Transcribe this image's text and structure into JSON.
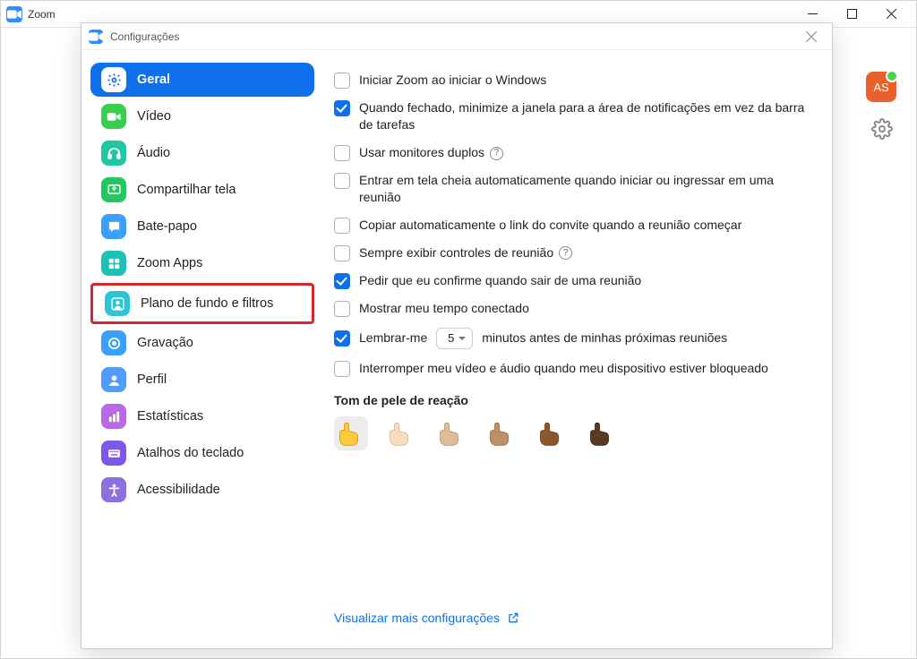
{
  "mainWindow": {
    "title": "Zoom",
    "avatar": "AS"
  },
  "dialog": {
    "title": "Configurações"
  },
  "sidebar": {
    "items": [
      {
        "label": "Geral",
        "iconBg": "#ffffff",
        "iconFg": "#0e71eb",
        "selected": true
      },
      {
        "label": "Vídeo",
        "iconBg": "#36d04d"
      },
      {
        "label": "Áudio",
        "iconBg": "#1fc7a6"
      },
      {
        "label": "Compartilhar tela",
        "iconBg": "#22c75f"
      },
      {
        "label": "Bate-papo",
        "iconBg": "#3aa0ff"
      },
      {
        "label": "Zoom Apps",
        "iconBg": "#1cc1b8"
      },
      {
        "label": "Plano de fundo e filtros",
        "iconBg": "#2fc3d8",
        "highlighted": true
      },
      {
        "label": "Gravação",
        "iconBg": "#3aa0ff"
      },
      {
        "label": "Perfil",
        "iconBg": "#4f9dff"
      },
      {
        "label": "Estatísticas",
        "iconBg": "#b968e8"
      },
      {
        "label": "Atalhos do teclado",
        "iconBg": "#7e57e8"
      },
      {
        "label": "Acessibilidade",
        "iconBg": "#8e6fe0"
      }
    ]
  },
  "options": {
    "start_windows": {
      "text": "Iniciar Zoom ao iniciar o Windows",
      "checked": false
    },
    "minimize_tray": {
      "text": "Quando fechado, minimize a janela para a área de notificações em vez da barra de tarefas",
      "checked": true
    },
    "dual_monitors": {
      "text": "Usar monitores duplos",
      "checked": false,
      "help": true
    },
    "fullscreen": {
      "text": "Entrar em tela cheia automaticamente quando iniciar ou ingressar em uma reunião",
      "checked": false
    },
    "copy_invite": {
      "text": "Copiar automaticamente o link do convite quando a reunião começar",
      "checked": false
    },
    "always_controls": {
      "text": "Sempre exibir controles de reunião",
      "checked": false,
      "help": true
    },
    "confirm_leave": {
      "text": "Pedir que eu confirme quando sair de uma reunião",
      "checked": true
    },
    "show_connected": {
      "text": "Mostrar meu tempo conectado",
      "checked": false
    },
    "remind": {
      "before": "Lembrar-me",
      "value": "5",
      "after": "minutos antes de minhas próximas reuniões",
      "checked": true
    },
    "stop_av_locked": {
      "text": "Interromper meu vídeo e áudio quando meu dispositivo estiver bloqueado",
      "checked": false
    }
  },
  "skin": {
    "heading": "Tom de pele de reação",
    "tones": [
      "#ffc83d",
      "#fadcbc",
      "#e0bb95",
      "#bf8f68",
      "#8e562e",
      "#5a3b22"
    ]
  },
  "footer": {
    "link": "Visualizar mais configurações"
  }
}
